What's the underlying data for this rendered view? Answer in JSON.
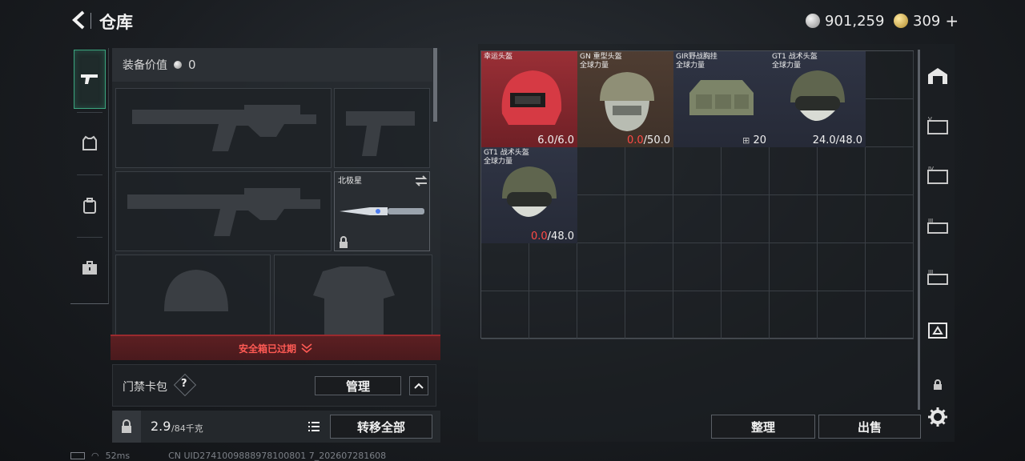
{
  "header": {
    "title": "仓库",
    "silver_amount": "901,259",
    "gold_amount": "309",
    "gold_add": "+"
  },
  "equipment": {
    "value_label": "装备价值",
    "value": "0",
    "secondary_weapon_name": "北极星",
    "expired_text": "安全箱已过期",
    "keycard_label": "门禁卡包",
    "keycard_help": "?",
    "manage_label": "管理",
    "weight_current": "2.9",
    "weight_max": "/84千克",
    "transfer_all_label": "转移全部"
  },
  "inventory": {
    "items": [
      {
        "name": "幸运头盔",
        "sub": "",
        "value": "6.0",
        "max": "/6.0",
        "value_red": false
      },
      {
        "name": "GN 重型头盔",
        "sub": "全球力量",
        "value": "0.0",
        "max": "/50.0",
        "value_red": true
      },
      {
        "name": "GIR野战胸挂",
        "sub": "全球力量",
        "value": "20",
        "max": "",
        "value_red": false
      },
      {
        "name": "GT1 战术头盔",
        "sub": "全球力量",
        "value": "24.0",
        "max": "/48.0",
        "value_red": false
      },
      {
        "name": "GT1 战术头盔",
        "sub": "全球力量",
        "value": "0.0",
        "max": "/48.0",
        "value_red": true
      }
    ],
    "sort_label": "整理",
    "sell_label": "出售"
  },
  "status": {
    "ping": "52ms",
    "uid": "CN UID2741009888978100801 7_202607281608"
  },
  "colors": {
    "accent_green": "#3ba57e",
    "alert_red": "#ff4a45",
    "red_item_bg": "#8a2a30",
    "brown_item_bg": "#4a3a30",
    "blue_item_bg": "#2f3444"
  }
}
